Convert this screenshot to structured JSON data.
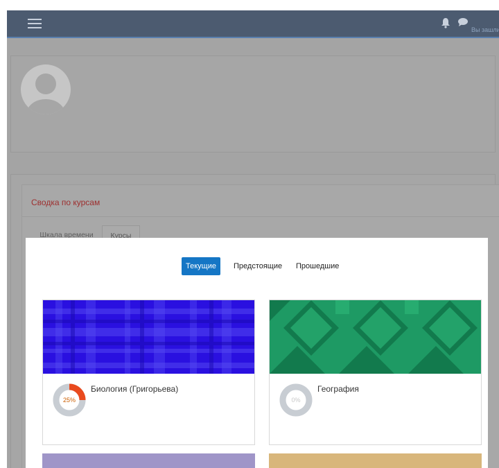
{
  "navbar": {
    "menu_icon": "hamburger-menu-icon",
    "notifications_icon": "bell-icon",
    "messages_icon": "chat-bubble-icon",
    "login_status": "Вы зашли",
    "background_color": "#4c5b70"
  },
  "profile": {
    "avatar_icon": "default-user-avatar-icon"
  },
  "overview": {
    "title": "Сводка по курсам",
    "tabs": [
      {
        "label": "Шкала времени",
        "active": false
      },
      {
        "label": "Курсы",
        "active": true
      }
    ]
  },
  "courses_panel": {
    "filters": [
      {
        "label": "Текущие",
        "active": true
      },
      {
        "label": "Предстоящие",
        "active": false
      },
      {
        "label": "Прошедшие",
        "active": false
      }
    ],
    "accent_color": "#1576c5",
    "courses": [
      {
        "name": "Биология (Григорьева)",
        "progress_label": "25%",
        "progress": 0.25,
        "image_pattern": "blue-plaid",
        "image_color": "#2a10e0"
      },
      {
        "name": "География",
        "progress_label": "0%",
        "progress": 0,
        "image_pattern": "green-geometric",
        "image_color": "#1e9a64"
      }
    ]
  }
}
